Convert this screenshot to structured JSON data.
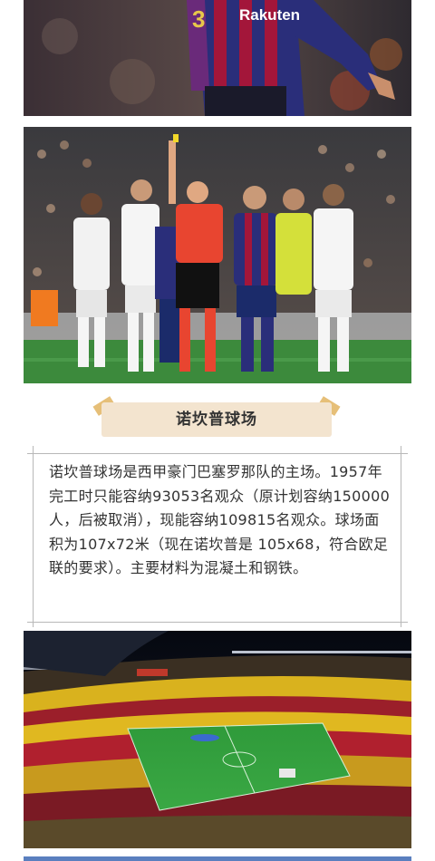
{
  "images": [
    {
      "name": "barcelona-player-photo",
      "jersey_text": "Rakuten",
      "jersey_number": "3"
    },
    {
      "name": "referee-yellow-card-photo"
    },
    {
      "name": "camp-nou-stadium-photo"
    }
  ],
  "section": {
    "title": "诺坎普球场",
    "paragraph": "诺坎普球场是西甲豪门巴塞罗那队的主场。1957年完工时只能容纳93053名观众（原计划容纳150000人，后被取消），现能容纳109815名观众。球场面积为107x72米（现在诺坎普是 105x68，符合欧足联的要求）。主要材料为混凝土和钢铁。"
  },
  "colors": {
    "banner": "#f3e4cf",
    "banner_tabs": "#e6bf78",
    "frame_lines": "#b8b8b8",
    "text": "#333333"
  }
}
